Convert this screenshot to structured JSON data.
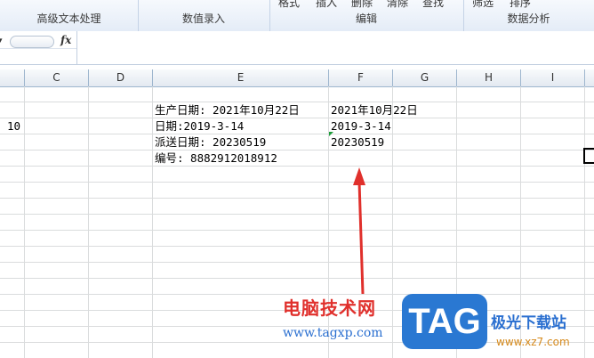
{
  "ribbon": {
    "groups": [
      {
        "label": "高级文本处理"
      },
      {
        "label": "数值录入"
      },
      {
        "label": "编辑"
      },
      {
        "label": "数据分析"
      }
    ],
    "top_fragments": [
      "格式",
      "插入",
      "删除",
      "清除",
      "查找",
      "筛选",
      "排序"
    ]
  },
  "formula_bar": {
    "fx_label": "fx",
    "value": ""
  },
  "columns": [
    "C",
    "D",
    "E",
    "F",
    "G",
    "H",
    "I"
  ],
  "cells": {
    "b2": "10",
    "e1": "生产日期: 2021年10月22日",
    "e2": "日期:2019-3-14",
    "e3": "派送日期: 20230519",
    "e4": "编号: 8882912018912",
    "f1": "2021年10月22日",
    "f2": "2019-3-14",
    "f3": "20230519"
  },
  "watermark": {
    "site_cn": "电脑技术网",
    "site_url": "www.tagxp.com",
    "logo_text": "TAG",
    "brand2": "极光下载站",
    "url2": "www.xz7.com"
  },
  "colors": {
    "arrow": "#e0302c",
    "error_triangle": "#1e9c3a",
    "logo_bg": "#2a78d2"
  }
}
